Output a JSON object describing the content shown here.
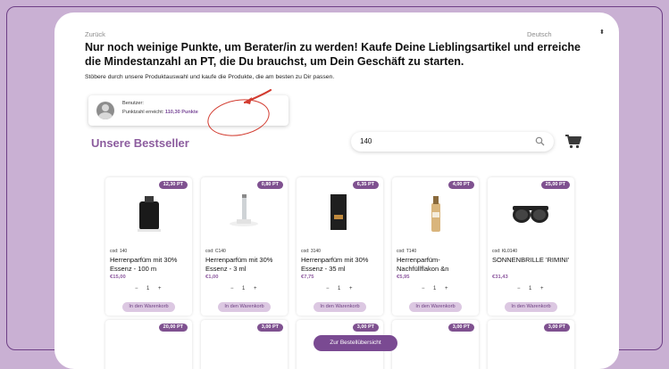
{
  "nav": {
    "back_label": "Zurück",
    "language": "Deutsch"
  },
  "headline": "Nur noch weinige Punkte, um Berater/in zu werden! Kaufe Deine Lieblingsartikel und erreiche die Mindestanzahl an PT, die Du brauchst, um Dein Geschäft zu starten.",
  "subtext": "Stöbere durch unsere Produktauswahl und kaufe die Produkte, die am besten zu Dir passen.",
  "user": {
    "label": "Benutzer:",
    "points_prefix": "Punktzahl erreicht:",
    "points_value": "110,30 Punkte"
  },
  "section_title": "Unsere Bestseller",
  "search": {
    "value": "140"
  },
  "products": [
    {
      "badge": "12,30 PT",
      "code": "cod: 140",
      "name": "Herrenparfüm mit 30% Essenz - 100 m",
      "price": "€15,00",
      "qty": "1",
      "cart_label": "In den Warenkorb",
      "image": "perfume-bottle-black-image"
    },
    {
      "badge": "0,80 PT",
      "code": "cod: C140",
      "name": "Herrenparfüm mit 30% Essenz - 3 ml",
      "price": "€1,00",
      "qty": "1",
      "cart_label": "In den Warenkorb",
      "image": "perfume-vial-image"
    },
    {
      "badge": "6,35 PT",
      "code": "cod: 3140",
      "name": "Herrenparfüm mit 30% Essenz - 35 ml",
      "price": "€7,75",
      "qty": "1",
      "cart_label": "In den Warenkorb",
      "image": "perfume-box-image"
    },
    {
      "badge": "4,00 PT",
      "code": "cod: T140",
      "name": "Herrenparfüm-Nachfüllflakon &n",
      "price": "€5,95",
      "qty": "1",
      "cart_label": "In den Warenkorb",
      "image": "refill-flacon-image"
    },
    {
      "badge": "25,00 PT",
      "code": "cod: KL0140",
      "name": "SONNENBRILLE 'RIMINI'",
      "price": "€31,43",
      "qty": "1",
      "cart_label": "In den Warenkorb",
      "image": "sunglasses-image"
    }
  ],
  "products_row2_badges": [
    "20,00 PT",
    "3,00 PT",
    "3,00 PT",
    "3,00 PT",
    "3,00 PT"
  ],
  "overview_button": "Zur Bestellübersicht",
  "colors": {
    "accent": "#7a4a92",
    "title": "#8c5c9e",
    "annotation": "#d23b2f",
    "background": "#c9b0d3"
  }
}
